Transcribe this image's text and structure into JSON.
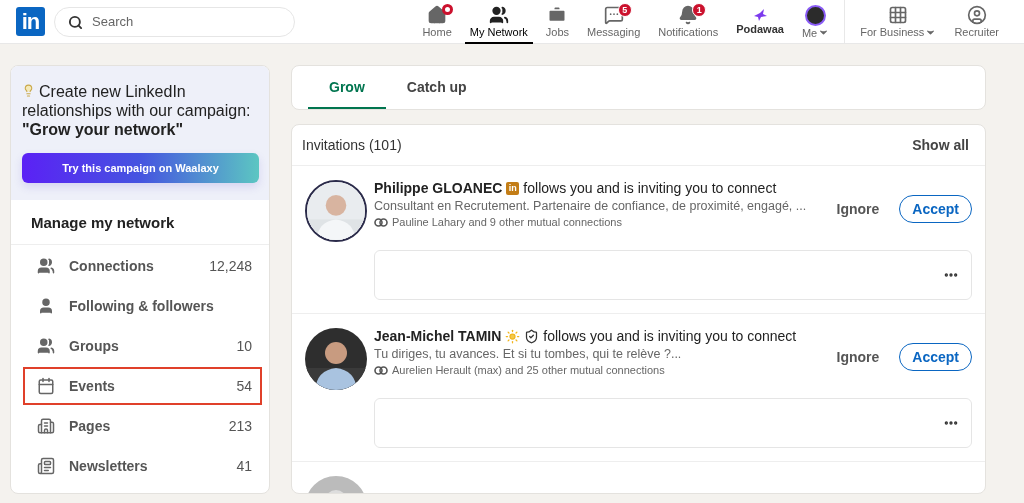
{
  "header": {
    "logo": "in",
    "search": {
      "placeholder": "Search"
    },
    "nav": [
      {
        "label": "Home",
        "kind": "home",
        "selected": false,
        "dot": true,
        "caret": false
      },
      {
        "label": "My Network",
        "kind": "network",
        "selected": true,
        "dot": false,
        "caret": false
      },
      {
        "label": "Jobs",
        "kind": "jobs",
        "selected": false,
        "dot": false,
        "caret": false
      },
      {
        "label": "Messaging",
        "kind": "messaging",
        "selected": false,
        "dot": false,
        "caret": false,
        "badge": "5"
      },
      {
        "label": "Notifications",
        "kind": "bell",
        "selected": false,
        "dot": false,
        "caret": false,
        "badge": "1"
      },
      {
        "label": "Podawaa",
        "kind": "podawaa",
        "selected": false,
        "dot": false,
        "caret": false
      },
      {
        "label": "Me",
        "kind": "avatar",
        "selected": false,
        "dot": false,
        "caret": true
      },
      {
        "label": "For Business",
        "kind": "grid",
        "selected": false,
        "dot": false,
        "caret": true
      },
      {
        "label": "Recruiter",
        "kind": "recruiter",
        "selected": false,
        "dot": false,
        "caret": false
      }
    ]
  },
  "promo": {
    "text": "Create new LinkedIn relationships with our campaign: **\"Grow your network\"**",
    "button": "Try this campaign on Waalaxy"
  },
  "manage": {
    "title": "Manage my network",
    "items": [
      {
        "label": "Connections",
        "count": "12,248",
        "kind": "connections",
        "highlighted": false
      },
      {
        "label": "Following & followers",
        "kind": "person",
        "highlighted": false
      },
      {
        "label": "Groups",
        "count": "10",
        "kind": "groups",
        "highlighted": false
      },
      {
        "label": "Events",
        "count": "54",
        "kind": "calendar",
        "highlighted": true
      },
      {
        "label": "Pages",
        "count": "213",
        "kind": "building",
        "highlighted": false
      },
      {
        "label": "Newsletters",
        "count": "41",
        "kind": "newsletter",
        "highlighted": false
      }
    ]
  },
  "tabs": [
    {
      "label": "Grow",
      "selected": true
    },
    {
      "label": "Catch up",
      "selected": false
    }
  ],
  "invitations": {
    "title": "Invitations (101)",
    "show_all": "Show all",
    "items": [
      {
        "name": "Philippe GLOANEC",
        "badges": [
          {
            "kind": "premium",
            "text": "in"
          }
        ],
        "message": "follows you and is inviting you to connect",
        "headline": "Consultant en Recrutement. Partenaire de confiance, de proximité, engagé, ...",
        "mutual": "Pauline Lahary and 9 other mutual connections",
        "ignore": "Ignore",
        "accept": "Accept"
      },
      {
        "name": "Jean-Michel TAMIN",
        "badges": [
          {
            "kind": "sun"
          },
          {
            "kind": "shield"
          }
        ],
        "message": "follows you and is inviting you to connect",
        "headline": "Tu diriges, tu avances. Et si tu tombes, qui te relève ?...",
        "mutual": "Aurelien Herault (max) and 25 other mutual connections",
        "ignore": "Ignore",
        "accept": "Accept"
      }
    ]
  }
}
